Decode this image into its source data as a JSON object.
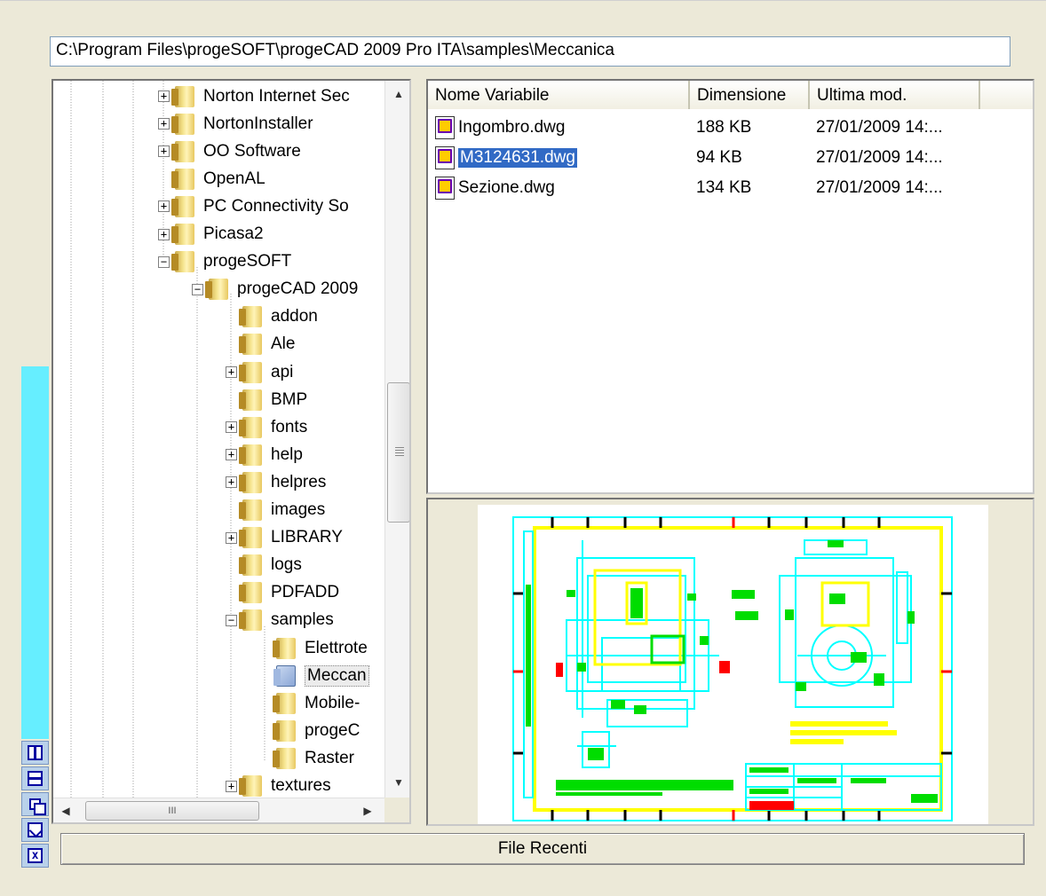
{
  "path": "C:\\Program Files\\progeSOFT\\progeCAD 2009 Pro ITA\\samples\\Meccanica",
  "tree": {
    "items": [
      {
        "label": "Norton Internet Sec",
        "expander": "+",
        "level": 0
      },
      {
        "label": "NortonInstaller",
        "expander": "+",
        "level": 0
      },
      {
        "label": "OO Software",
        "expander": "+",
        "level": 0
      },
      {
        "label": "OpenAL",
        "expander": "",
        "level": 0
      },
      {
        "label": "PC Connectivity So",
        "expander": "+",
        "level": 0
      },
      {
        "label": "Picasa2",
        "expander": "+",
        "level": 0
      },
      {
        "label": "progeSOFT",
        "expander": "−",
        "level": 0
      },
      {
        "label": "progeCAD 2009",
        "expander": "−",
        "level": 1
      },
      {
        "label": "addon",
        "expander": "",
        "level": 2
      },
      {
        "label": "Ale",
        "expander": "",
        "level": 2
      },
      {
        "label": "api",
        "expander": "+",
        "level": 2
      },
      {
        "label": "BMP",
        "expander": "",
        "level": 2
      },
      {
        "label": "fonts",
        "expander": "+",
        "level": 2
      },
      {
        "label": "help",
        "expander": "+",
        "level": 2
      },
      {
        "label": "helpres",
        "expander": "+",
        "level": 2
      },
      {
        "label": "images",
        "expander": "",
        "level": 2
      },
      {
        "label": "LIBRARY",
        "expander": "+",
        "level": 2
      },
      {
        "label": "logs",
        "expander": "",
        "level": 2
      },
      {
        "label": "PDFADD",
        "expander": "",
        "level": 2
      },
      {
        "label": "samples",
        "expander": "−",
        "level": 2
      },
      {
        "label": "Elettrote",
        "expander": "",
        "level": 3
      },
      {
        "label": "Meccan",
        "expander": "",
        "level": 3,
        "selected": true
      },
      {
        "label": "Mobile-",
        "expander": "",
        "level": 3
      },
      {
        "label": "progeC",
        "expander": "",
        "level": 3
      },
      {
        "label": "Raster",
        "expander": "",
        "level": 3
      },
      {
        "label": "textures",
        "expander": "+",
        "level": 2
      }
    ],
    "hscroll_grip": "III"
  },
  "list": {
    "columns": [
      "Nome Variabile",
      "Dimensione",
      "Ultima mod."
    ],
    "rows": [
      {
        "name": "Ingombro.dwg",
        "size": "188 KB",
        "modified": "27/01/2009  14:..."
      },
      {
        "name": "M3124631.dwg",
        "size": "94 KB",
        "modified": "27/01/2009  14:...",
        "selected": true
      },
      {
        "name": "Sezione.dwg",
        "size": "134 KB",
        "modified": "27/01/2009  14:..."
      }
    ]
  },
  "recent_button": "File Recenti",
  "colors": {
    "side_strip": "#66eeff",
    "selection": "#316ac5",
    "preview_cyan": "#00ffff",
    "preview_yellow": "#ffff00",
    "preview_green": "#00dd00",
    "preview_red": "#ff0000"
  },
  "side_buttons": [
    "split-columns-icon",
    "split-rows-icon",
    "duplicate-icon",
    "pin-icon",
    "close-icon"
  ]
}
